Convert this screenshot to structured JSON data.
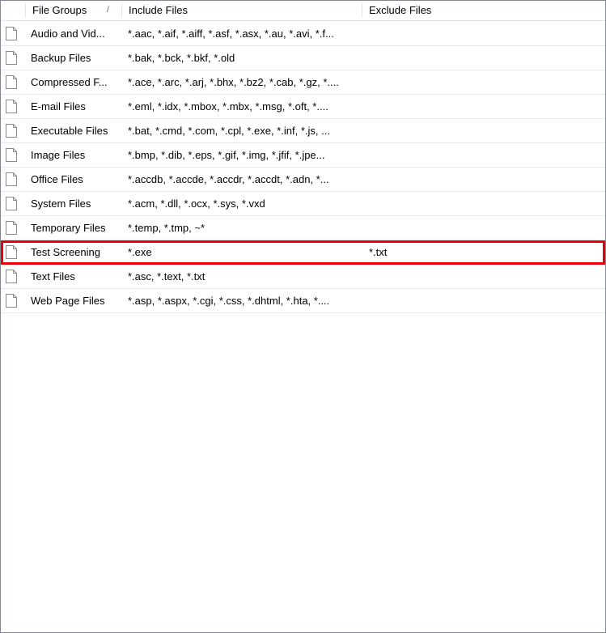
{
  "columns": {
    "name": "File Groups",
    "include": "Include Files",
    "exclude": "Exclude Files"
  },
  "rows": [
    {
      "name": "Audio and Vid...",
      "include": "*.aac, *.aif, *.aiff, *.asf, *.asx, *.au, *.avi, *.f...",
      "exclude": ""
    },
    {
      "name": "Backup Files",
      "include": "*.bak, *.bck, *.bkf, *.old",
      "exclude": ""
    },
    {
      "name": "Compressed F...",
      "include": "*.ace, *.arc, *.arj, *.bhx, *.bz2, *.cab, *.gz, *....",
      "exclude": ""
    },
    {
      "name": "E-mail Files",
      "include": "*.eml, *.idx, *.mbox, *.mbx, *.msg, *.oft, *....",
      "exclude": ""
    },
    {
      "name": "Executable Files",
      "include": "*.bat, *.cmd, *.com, *.cpl, *.exe, *.inf, *.js, ...",
      "exclude": ""
    },
    {
      "name": "Image Files",
      "include": "*.bmp, *.dib, *.eps, *.gif, *.img, *.jfif, *.jpe...",
      "exclude": ""
    },
    {
      "name": "Office Files",
      "include": "*.accdb, *.accde, *.accdr, *.accdt, *.adn, *...",
      "exclude": ""
    },
    {
      "name": "System Files",
      "include": "*.acm, *.dll, *.ocx, *.sys, *.vxd",
      "exclude": ""
    },
    {
      "name": "Temporary Files",
      "include": "*.temp, *.tmp, ~*",
      "exclude": ""
    },
    {
      "name": "Test Screening",
      "include": "*.exe",
      "exclude": "*.txt"
    },
    {
      "name": "Text Files",
      "include": "*.asc, *.text, *.txt",
      "exclude": ""
    },
    {
      "name": "Web Page Files",
      "include": "*.asp, *.aspx, *.cgi, *.css, *.dhtml, *.hta, *....",
      "exclude": ""
    }
  ],
  "sort_indicator": "/",
  "icons": {
    "row": "document-icon"
  },
  "colors": {
    "selection_outline": "#e8000b"
  }
}
